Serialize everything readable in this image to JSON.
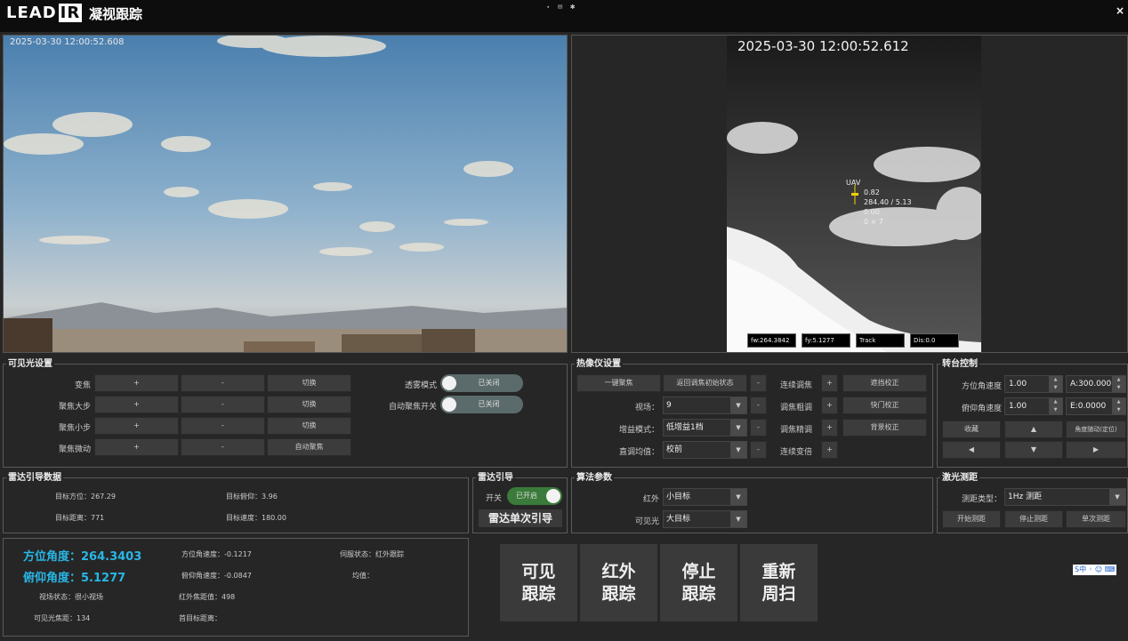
{
  "app": {
    "logo_text": "LEAD",
    "logo_box": "IR",
    "title": "凝视跟踪",
    "window_icons": "⋆ ✉ ✱",
    "close": "×"
  },
  "video": {
    "visible_timestamp": "2025-03-30  12:00:52.608",
    "ir_timestamp": "2025-03-30  12:00:52.612",
    "ir_overlay": [
      "UAV",
      "0.82",
      "284.40 / 5.13",
      "0.00",
      "0 × 7"
    ],
    "ir_status": {
      "fw": "fw:264.3842",
      "fy": "fy:5.1277",
      "mode": "Track",
      "dis": "Dis:0.0"
    }
  },
  "visible_settings": {
    "title": "可见光设置",
    "rows": [
      {
        "label": "变焦",
        "b1": "+",
        "b2": "-",
        "b3": "切换"
      },
      {
        "label": "聚焦大步",
        "b1": "+",
        "b2": "-",
        "b3": "切换"
      },
      {
        "label": "聚焦小步",
        "b1": "+",
        "b2": "-",
        "b3": "切换"
      },
      {
        "label": "聚焦微动",
        "b1": "+",
        "b2": "-",
        "b3": "自动聚焦"
      }
    ],
    "defog_label": "透雾模式",
    "defog_state": "已关闭",
    "autofocus_label": "自动聚焦开关",
    "autofocus_state": "已关闭"
  },
  "thermal_settings": {
    "title": "热像仪设置",
    "one_key_focus": "一键聚焦",
    "return_factory": "返回调焦初始状态",
    "minus": "-",
    "plus": "+",
    "cont_zoom": "连续调焦",
    "shutter_correct": "遮挡校正",
    "fov_label": "视场：",
    "fov_value": "9",
    "coarse_focus": "调焦粗调",
    "shutter_correct2": "快门校正",
    "gain_label": "增益模式：",
    "gain_value": "低增益1档",
    "fine_focus": "调焦精调",
    "bg_correct": "背景校正",
    "equalize_label": "直调均值：",
    "equalize_value": "校前",
    "cont_zoom2": "连续变倍"
  },
  "turret": {
    "title": "转台控制",
    "az_speed_label": "方位角速度",
    "az_speed": "1.00",
    "az_value": "A:300.000",
    "el_speed_label": "俯仰角速度",
    "el_speed": "1.00",
    "el_value": "E:0.0000",
    "stow": "收藏",
    "angle_follow": "角度随动(定位)",
    "up": "▲",
    "down": "▼",
    "left": "◀",
    "right": "▶"
  },
  "radar_data": {
    "title": "雷达引导数据",
    "target_az": "目标方位：267.29",
    "target_el": "目标俯仰：3.96",
    "target_dist": "目标距离：771",
    "target_speed": "目标速度：180.00"
  },
  "radar_guide": {
    "title": "雷达引导",
    "switch_label": "开关",
    "switch_state": "已开启",
    "single_guide": "雷达单次引导"
  },
  "algo": {
    "title": "算法参数",
    "ir_label": "红外",
    "ir_value": "小目标",
    "vis_label": "可见光",
    "vis_value": "大目标"
  },
  "laser": {
    "title": "激光测距",
    "type_label": "测距类型：",
    "type_value": "1Hz 测距",
    "start": "开始测距",
    "stop": "停止测距",
    "single": "单次测距"
  },
  "status": {
    "az_angle": "方位角度：264.3403",
    "el_angle": "俯仰角度：5.1277",
    "az_rate": "方位角速度：-0.1217",
    "el_rate": "俯仰角速度：-0.0847",
    "servo_state": "伺服状态：红外跟踪",
    "balance": "均值：",
    "fov_state": "视场状态：很小视场",
    "ir_focus": "红外焦距值：498",
    "vis_focus": "可见光焦距：134",
    "first_target_dist": "首目标距离："
  },
  "track_buttons": {
    "visible": "可见\n跟踪",
    "infrared": "红外\n跟踪",
    "stop": "停止\n跟踪",
    "rescan": "重新\n周扫"
  },
  "ime_badge": "S中 ◦ ☺ ⌨"
}
